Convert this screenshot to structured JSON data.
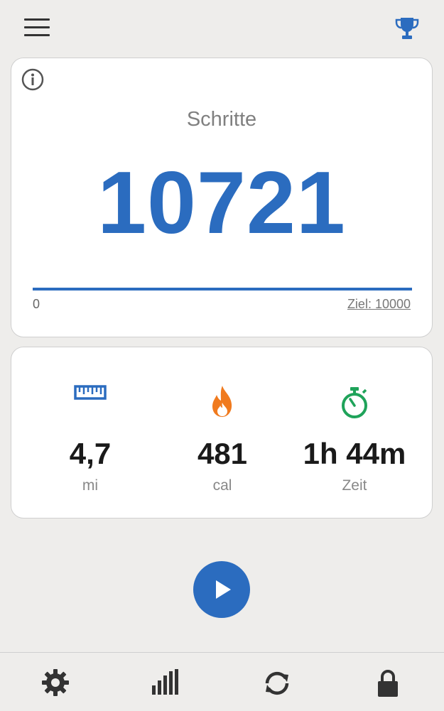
{
  "header": {
    "menu_icon": "hamburger-menu-icon",
    "trophy_icon": "trophy-icon",
    "accent_color": "#2b6cbf"
  },
  "steps": {
    "label": "Schritte",
    "value": "10721",
    "progress_min": "0",
    "goal_label": "Ziel: 10000",
    "progress_fraction": 1.0,
    "info_icon": "info-icon"
  },
  "stats": [
    {
      "icon": "ruler-icon",
      "value": "4,7",
      "unit": "mi",
      "color": "#2b6cbf"
    },
    {
      "icon": "flame-icon",
      "value": "481",
      "unit": "cal",
      "color": "#f07a1e"
    },
    {
      "icon": "stopwatch-icon",
      "value": "1h 44m",
      "unit": "Zeit",
      "color": "#1fa35a"
    }
  ],
  "play_button": {
    "icon": "play-icon"
  },
  "bottom_nav": [
    {
      "icon": "gear-icon"
    },
    {
      "icon": "bar-chart-icon"
    },
    {
      "icon": "refresh-icon"
    },
    {
      "icon": "lock-icon"
    }
  ]
}
